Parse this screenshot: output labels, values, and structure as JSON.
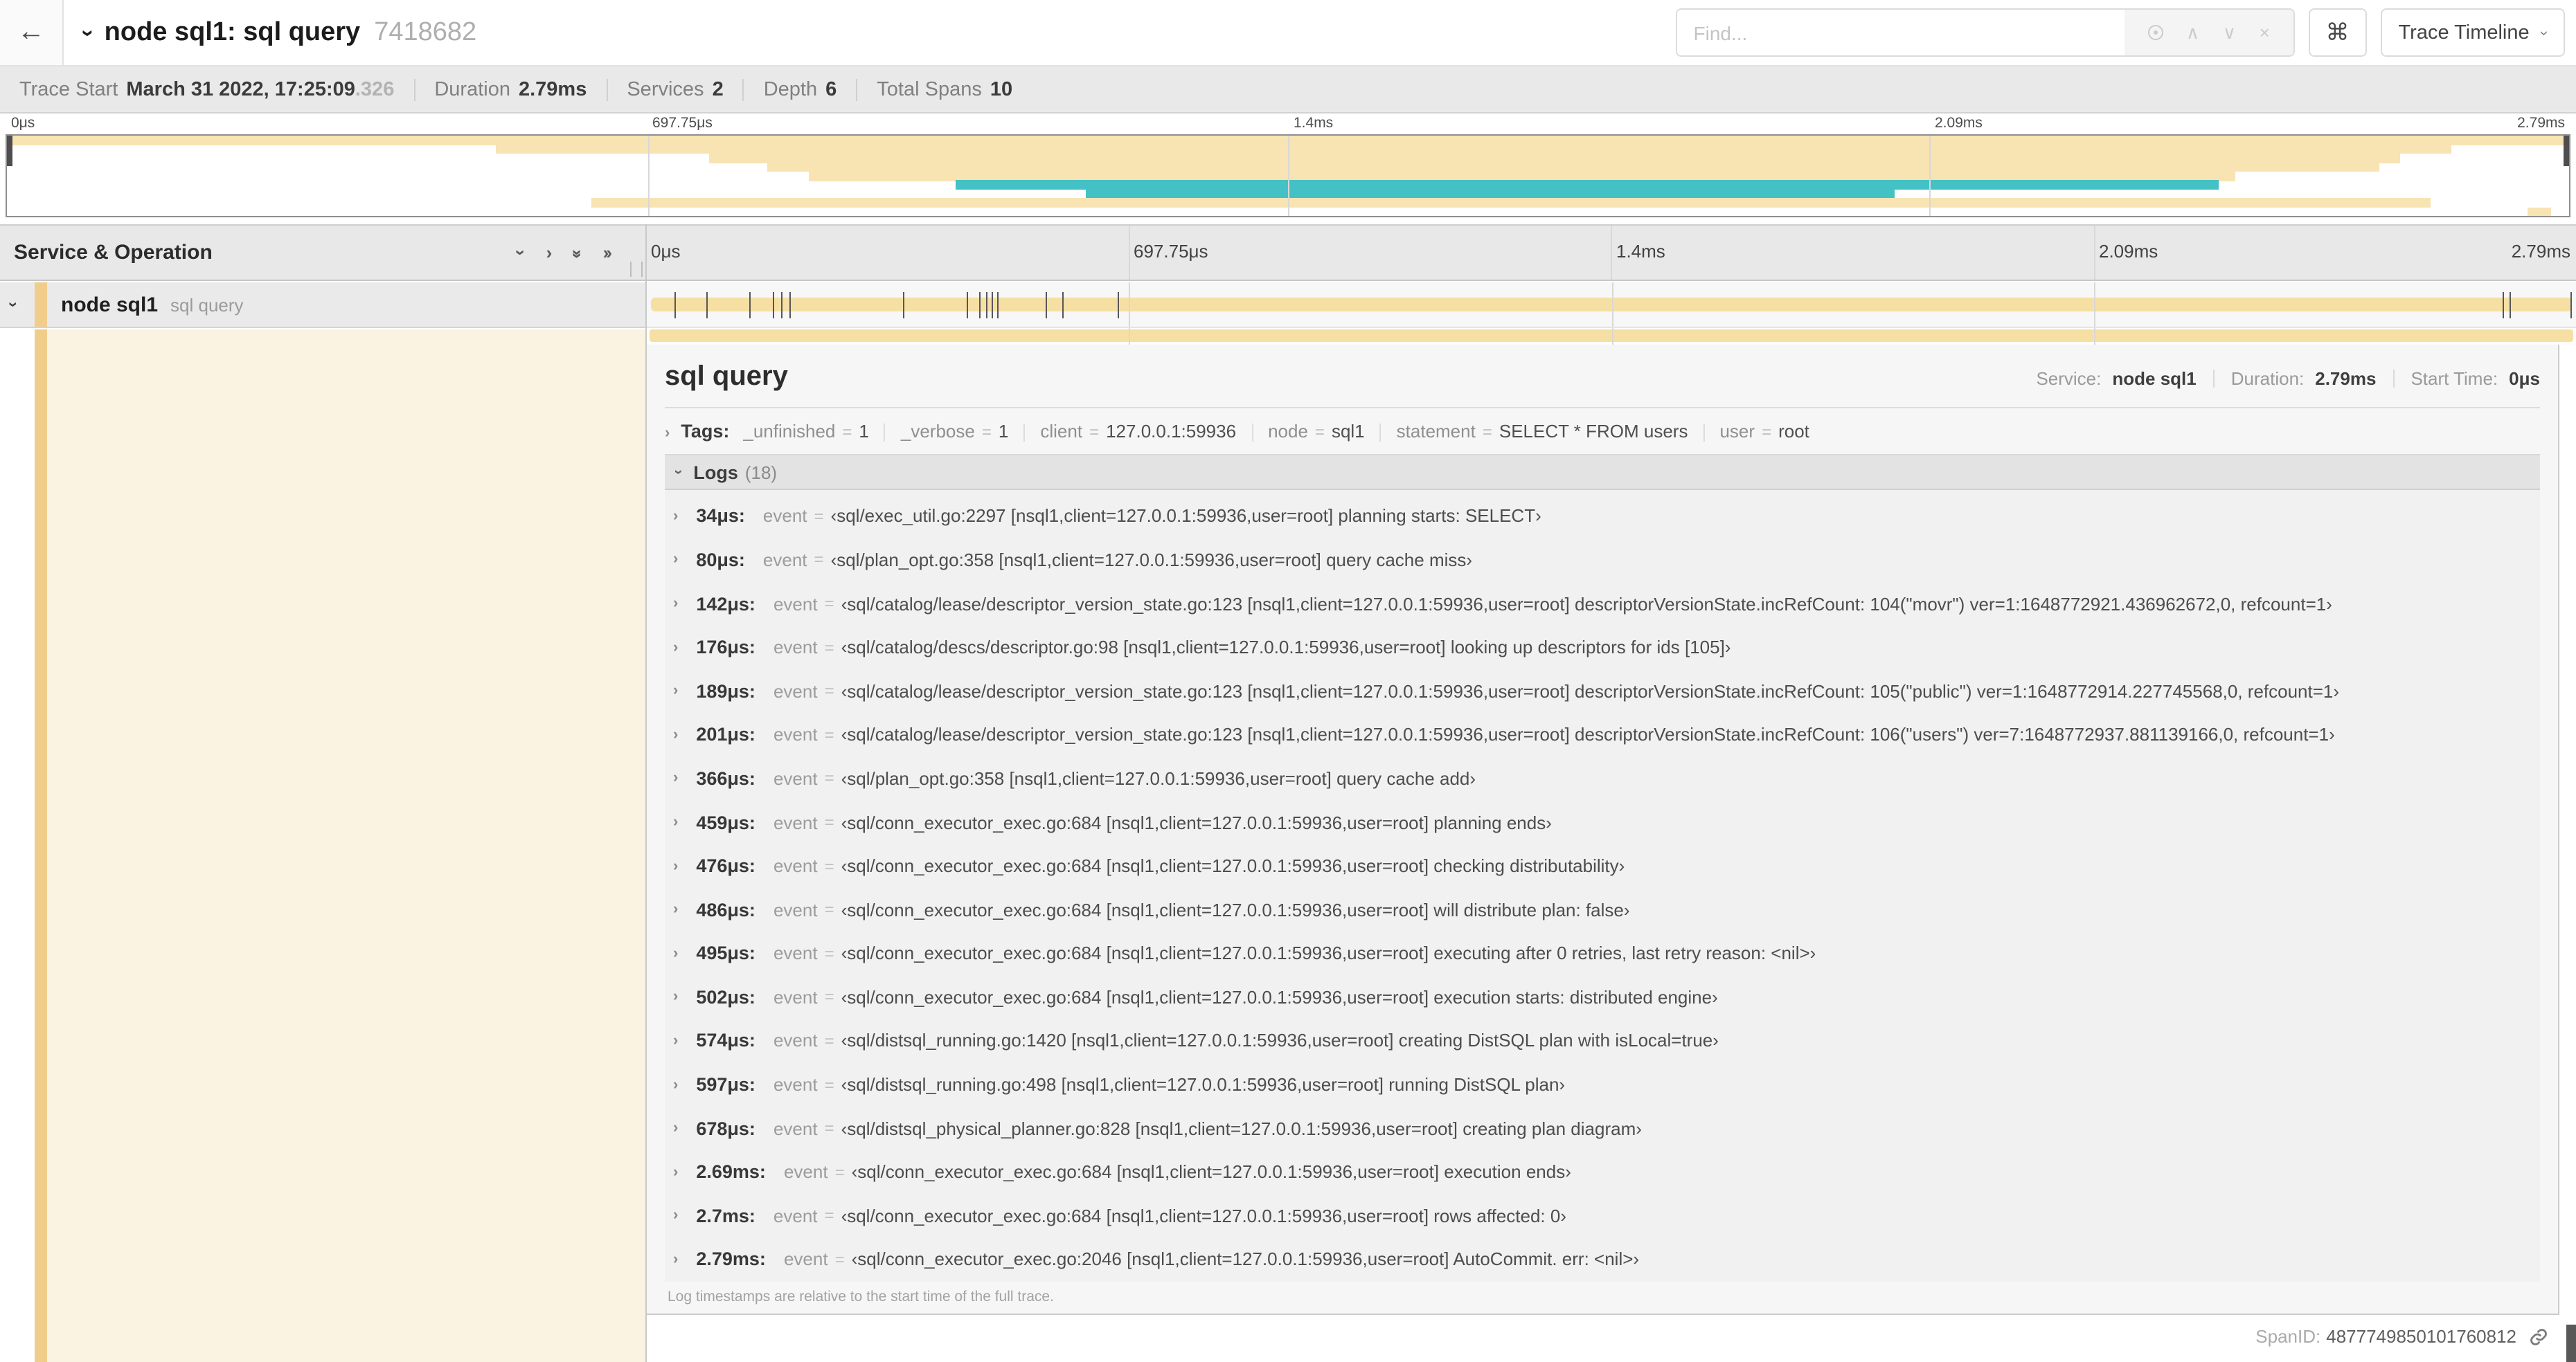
{
  "colors": {
    "tan": "#f8e3b3",
    "tan_bar": "#f6dfa3",
    "tan_stripe": "#f1cd8c",
    "teal": "#44c1c4",
    "cream": "#faf3e1",
    "header_gray": "#e8e8e8",
    "detail_bg": "#f6f6f6"
  },
  "icons": {
    "back": "←",
    "chevron": "›",
    "double_chevron": "››",
    "prev": "∧",
    "next": "∨",
    "close": "×",
    "command": "⌘"
  },
  "misc": {
    "eq": "="
  },
  "header": {
    "title": "node sql1: sql query",
    "trace_id": "7418682",
    "find_placeholder": "Find...",
    "view_selector": "Trace Timeline"
  },
  "summary": {
    "items": [
      {
        "label": "Trace Start",
        "value": "March 31 2022, 17:25:09",
        "value_muted": ".326"
      },
      {
        "label": "Duration",
        "value": "2.79ms"
      },
      {
        "label": "Services",
        "value": "2"
      },
      {
        "label": "Depth",
        "value": "6"
      },
      {
        "label": "Total Spans",
        "value": "10"
      }
    ]
  },
  "minimap": {
    "rows": [
      {
        "left": 0,
        "width": 100,
        "color": "tan"
      },
      {
        "left": 19.1,
        "width": 76.3,
        "color": "tan"
      },
      {
        "left": 27.4,
        "width": 66.0,
        "color": "tan"
      },
      {
        "left": 29.7,
        "width": 62.9,
        "color": "tan"
      },
      {
        "left": 31.3,
        "width": 55.7,
        "color": "tan"
      },
      {
        "left": 37.0,
        "width": 49.3,
        "color": "teal"
      },
      {
        "left": 42.1,
        "width": 31.6,
        "color": "teal"
      },
      {
        "left": 22.8,
        "width": 71.8,
        "color": "tan"
      },
      {
        "left": 98.4,
        "width": 0.9,
        "color": "tan"
      }
    ]
  },
  "timeline": {
    "left_header": "Service & Operation",
    "ruler_ticks": [
      {
        "label": "0μs",
        "pos": 0
      },
      {
        "label": "697.75μs",
        "pos": 25
      },
      {
        "label": "1.4ms",
        "pos": 50
      },
      {
        "label": "2.09ms",
        "pos": 75
      },
      {
        "label": "2.79ms",
        "pos": 100
      }
    ],
    "span": {
      "service": "node sql1",
      "operation": "sql query"
    },
    "marker_percents": [
      1.22,
      2.87,
      5.09,
      6.31,
      6.77,
      7.2,
      13.12,
      16.45,
      17.06,
      17.42,
      17.74,
      18.0,
      20.57,
      21.4,
      24.3,
      96.42,
      96.77,
      99.93
    ]
  },
  "detail": {
    "title": "sql query",
    "service_label": "Service:",
    "service": "node sql1",
    "duration_label": "Duration:",
    "duration": "2.79ms",
    "start_label": "Start Time:",
    "start": "0μs",
    "tags": {
      "label": "Tags:",
      "items": [
        {
          "key": "_unfinished",
          "value": "1"
        },
        {
          "key": "_verbose",
          "value": "1"
        },
        {
          "key": "client",
          "value": "127.0.0.1:59936"
        },
        {
          "key": "node",
          "value": "sql1"
        },
        {
          "key": "statement",
          "value": "SELECT * FROM users"
        },
        {
          "key": "user",
          "value": "root"
        }
      ]
    },
    "logs": {
      "label": "Logs",
      "count": "(18)",
      "field_key": "event",
      "entries": [
        {
          "time": "34μs:",
          "value": "‹sql/exec_util.go:2297 [nsql1,client=127.0.0.1:59936,user=root] planning starts: SELECT›"
        },
        {
          "time": "80μs:",
          "value": "‹sql/plan_opt.go:358 [nsql1,client=127.0.0.1:59936,user=root] query cache miss›"
        },
        {
          "time": "142μs:",
          "value": "‹sql/catalog/lease/descriptor_version_state.go:123 [nsql1,client=127.0.0.1:59936,user=root] descriptorVersionState.incRefCount: 104(\"movr\") ver=1:1648772921.436962672,0, refcount=1›"
        },
        {
          "time": "176μs:",
          "value": "‹sql/catalog/descs/descriptor.go:98 [nsql1,client=127.0.0.1:59936,user=root] looking up descriptors for ids [105]›"
        },
        {
          "time": "189μs:",
          "value": "‹sql/catalog/lease/descriptor_version_state.go:123 [nsql1,client=127.0.0.1:59936,user=root] descriptorVersionState.incRefCount: 105(\"public\") ver=1:1648772914.227745568,0, refcount=1›"
        },
        {
          "time": "201μs:",
          "value": "‹sql/catalog/lease/descriptor_version_state.go:123 [nsql1,client=127.0.0.1:59936,user=root] descriptorVersionState.incRefCount: 106(\"users\") ver=7:1648772937.881139166,0, refcount=1›"
        },
        {
          "time": "366μs:",
          "value": "‹sql/plan_opt.go:358 [nsql1,client=127.0.0.1:59936,user=root] query cache add›"
        },
        {
          "time": "459μs:",
          "value": "‹sql/conn_executor_exec.go:684 [nsql1,client=127.0.0.1:59936,user=root] planning ends›"
        },
        {
          "time": "476μs:",
          "value": "‹sql/conn_executor_exec.go:684 [nsql1,client=127.0.0.1:59936,user=root] checking distributability›"
        },
        {
          "time": "486μs:",
          "value": "‹sql/conn_executor_exec.go:684 [nsql1,client=127.0.0.1:59936,user=root] will distribute plan: false›"
        },
        {
          "time": "495μs:",
          "value": "‹sql/conn_executor_exec.go:684 [nsql1,client=127.0.0.1:59936,user=root] executing after 0 retries, last retry reason: <nil>›"
        },
        {
          "time": "502μs:",
          "value": "‹sql/conn_executor_exec.go:684 [nsql1,client=127.0.0.1:59936,user=root] execution starts: distributed engine›"
        },
        {
          "time": "574μs:",
          "value": "‹sql/distsql_running.go:1420 [nsql1,client=127.0.0.1:59936,user=root] creating DistSQL plan with isLocal=true›"
        },
        {
          "time": "597μs:",
          "value": "‹sql/distsql_running.go:498 [nsql1,client=127.0.0.1:59936,user=root] running DistSQL plan›"
        },
        {
          "time": "678μs:",
          "value": "‹sql/distsql_physical_planner.go:828 [nsql1,client=127.0.0.1:59936,user=root] creating plan diagram›"
        },
        {
          "time": "2.69ms:",
          "value": "‹sql/conn_executor_exec.go:684 [nsql1,client=127.0.0.1:59936,user=root] execution ends›"
        },
        {
          "time": "2.7ms:",
          "value": "‹sql/conn_executor_exec.go:684 [nsql1,client=127.0.0.1:59936,user=root] rows affected: 0›"
        },
        {
          "time": "2.79ms:",
          "value": "‹sql/conn_executor_exec.go:2046 [nsql1,client=127.0.0.1:59936,user=root] AutoCommit. err: <nil>›"
        }
      ]
    },
    "footer_note": "Log timestamps are relative to the start time of the full trace.",
    "span_id_label": "SpanID:",
    "span_id": "4877749850101760812"
  }
}
